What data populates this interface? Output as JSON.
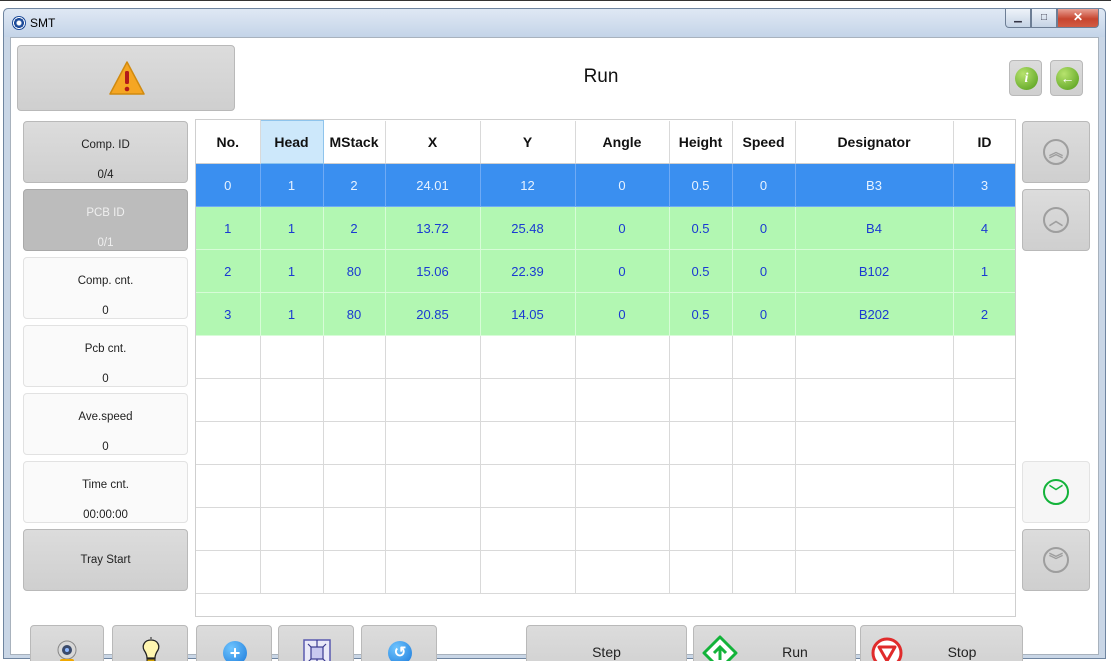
{
  "window": {
    "title": "SMT",
    "controls": [
      "minimize",
      "maximize",
      "close"
    ]
  },
  "header": {
    "title": "Run",
    "warning_icon": "warning-triangle-icon",
    "info_icon": "info-icon",
    "back_icon": "back-arrow-icon"
  },
  "sidebar": {
    "items": [
      {
        "label": "Comp. ID",
        "value": "0/4",
        "style": "button"
      },
      {
        "label": "PCB ID",
        "value": "0/1",
        "style": "disabled"
      },
      {
        "label": "Comp. cnt.",
        "value": "0",
        "style": "display"
      },
      {
        "label": "Pcb cnt.",
        "value": "0",
        "style": "display"
      },
      {
        "label": "Ave.speed",
        "value": "0",
        "style": "display"
      },
      {
        "label": "Time cnt.",
        "value": "00:00:00",
        "style": "display"
      },
      {
        "label": "Tray Start",
        "value": "",
        "style": "button"
      }
    ]
  },
  "table": {
    "columns": [
      "No.",
      "Head",
      "MStack",
      "X",
      "Y",
      "Angle",
      "Height",
      "Speed",
      "Designator",
      "ID"
    ],
    "selected_column": "Head",
    "rows": [
      [
        "0",
        "1",
        "2",
        "24.01",
        "12",
        "0",
        "0.5",
        "0",
        "B3",
        "3"
      ],
      [
        "1",
        "1",
        "2",
        "13.72",
        "25.48",
        "0",
        "0.5",
        "0",
        "B4",
        "4"
      ],
      [
        "2",
        "1",
        "80",
        "15.06",
        "22.39",
        "0",
        "0.5",
        "0",
        "B102",
        "1"
      ],
      [
        "3",
        "1",
        "80",
        "20.85",
        "14.05",
        "0",
        "0.5",
        "0",
        "B202",
        "2"
      ]
    ],
    "selected_row": 0,
    "empty_rows": 6
  },
  "scroll": {
    "icons": [
      "double-up-icon",
      "up-icon",
      "down-icon",
      "double-down-icon"
    ]
  },
  "toolbar": {
    "camera_icon": "camera-icon",
    "light_icon": "light-bulb-icon",
    "add_icon": "add-icon",
    "pcb_icon": "pcb-icon",
    "undo_icon": "undo-icon",
    "step_label": "Step",
    "run_label": "Run",
    "stop_label": "Stop"
  },
  "colors": {
    "selected_row": "#3a8ff0",
    "done_row": "#b2f7b2",
    "run_green": "#13b33a",
    "stop_red": "#e02b2b",
    "warning": "#f5a623"
  }
}
